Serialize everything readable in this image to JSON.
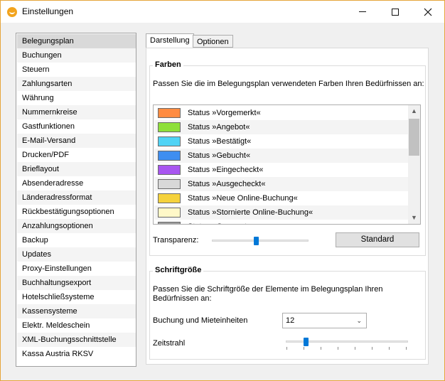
{
  "window": {
    "title": "Einstellungen",
    "accent": "#f2a41e"
  },
  "sidebar": {
    "items": [
      {
        "label": "Belegungsplan"
      },
      {
        "label": "Buchungen"
      },
      {
        "label": "Steuern"
      },
      {
        "label": "Zahlungsarten"
      },
      {
        "label": "Währung"
      },
      {
        "label": "Nummernkreise"
      },
      {
        "label": "Gastfunktionen"
      },
      {
        "label": "E-Mail-Versand"
      },
      {
        "label": "Drucken/PDF"
      },
      {
        "label": "Brieflayout"
      },
      {
        "label": "Absenderadresse"
      },
      {
        "label": "Länderadressformat"
      },
      {
        "label": "Rückbestätigungsoptionen"
      },
      {
        "label": "Anzahlungsoptionen"
      },
      {
        "label": "Backup"
      },
      {
        "label": "Updates"
      },
      {
        "label": "Proxy-Einstellungen"
      },
      {
        "label": "Buchhaltungsexport"
      },
      {
        "label": "Hotelschließsysteme"
      },
      {
        "label": "Kassensysteme"
      },
      {
        "label": "Elektr. Meldeschein"
      },
      {
        "label": "XML-Buchungsschnittstelle"
      },
      {
        "label": "Kassa Austria RKSV"
      }
    ],
    "selected": "Belegungsplan"
  },
  "tabs": [
    {
      "label": "Darstellung"
    },
    {
      "label": "Optionen"
    }
  ],
  "colors_group": {
    "title": "Farben",
    "description": "Passen Sie die im Belegungsplan verwendeten Farben Ihren Bedürfnissen an:",
    "rows": [
      {
        "label": "Status »Vorgemerkt«",
        "color": "#ff8c42"
      },
      {
        "label": "Status »Angebot«",
        "color": "#8ee03a"
      },
      {
        "label": "Status »Bestätigt«",
        "color": "#4fd3f5"
      },
      {
        "label": "Status »Gebucht«",
        "color": "#3f8ef0"
      },
      {
        "label": "Status »Eingecheckt«",
        "color": "#a855f0"
      },
      {
        "label": "Status »Ausgecheckt«",
        "color": "#d8d8d8"
      },
      {
        "label": "Status »Neue Online-Buchung«",
        "color": "#f5d23c"
      },
      {
        "label": "Status »Stornierte Online-Buchung«",
        "color": "#fff8c8"
      },
      {
        "label": "Status »Gesperrt«",
        "color": "#a0a0a0"
      }
    ],
    "transparency_label": "Transparenz:",
    "transparency_value": 0.45,
    "standard_button": "Standard"
  },
  "font_group": {
    "title": "Schriftgröße",
    "description_line1": "Passen Sie die Schriftgröße der Elemente im Belegungsplan Ihren",
    "description_line2": "Bedürfnissen an:",
    "booking_label": "Buchung und Mieteinheiten",
    "booking_value": "12",
    "timeline_label": "Zeitstrahl",
    "timeline_value": 0.15
  }
}
